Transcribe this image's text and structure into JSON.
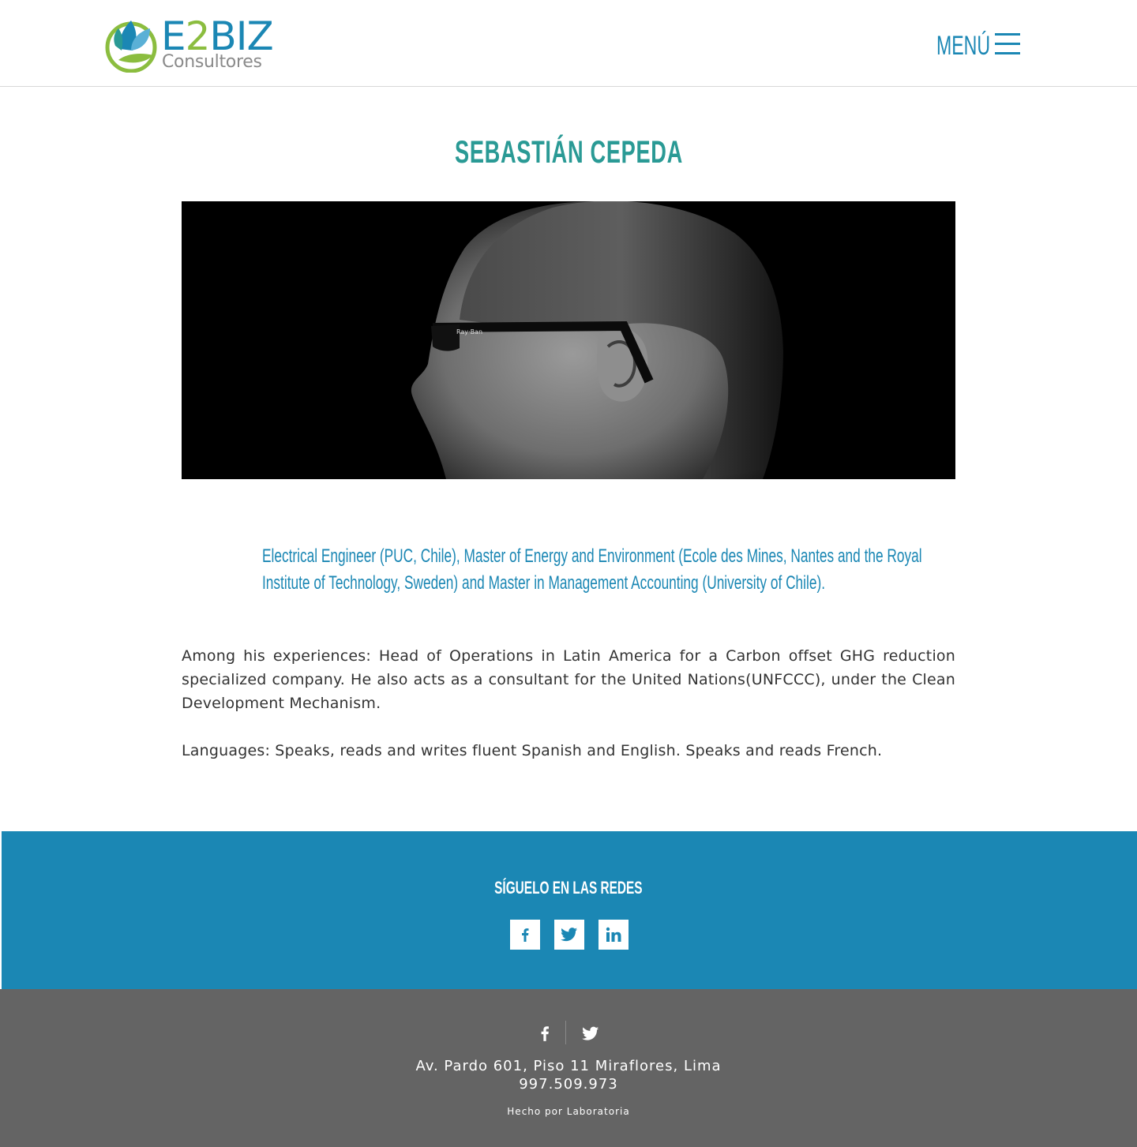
{
  "brand": {
    "name_part1": "E",
    "name_part2": "2",
    "name_part3": "BIZ",
    "tagline": "Consultores",
    "primary_color": "#1b87b4",
    "accent_color": "#8bbd3f",
    "title_color": "#2a9a95"
  },
  "header": {
    "menu_label": "MENÚ",
    "menu_icon": "hamburger-icon"
  },
  "profile": {
    "name": "SEBASTIÁN CEPEDA",
    "photo_icon": "portrait-photo",
    "credentials_line1": "Electrical Engineer (PUC, Chile), Master of Energy and Environment (Ecole des Mines, Nantes and the Royal",
    "credentials_line2": "Institute of Technology, Sweden) and Master in Management Accounting (University of Chile).",
    "bio": "Among his experiences:  Head of Operations in Latin America for a Carbon offset GHG reduction specialized company. He also acts as a consultant for the United Nations(UNFCCC), under the Clean Development Mechanism.",
    "languages": "Languages: Speaks, reads and writes fluent Spanish and English. Speaks and reads French."
  },
  "social": {
    "heading": "SÍGUELO EN LAS REDES",
    "band_color": "#1b87b4",
    "items": [
      {
        "name": "facebook",
        "icon": "facebook-icon"
      },
      {
        "name": "twitter",
        "icon": "twitter-icon"
      },
      {
        "name": "linkedin",
        "icon": "linkedin-icon"
      }
    ]
  },
  "footer": {
    "background_color": "#646464",
    "icons": [
      "facebook-icon",
      "twitter-icon"
    ],
    "address": "Av. Pardo 601, Piso 11 Miraflores, Lima",
    "phone": "997.509.973",
    "made_by": "Hecho por Laboratoria"
  }
}
